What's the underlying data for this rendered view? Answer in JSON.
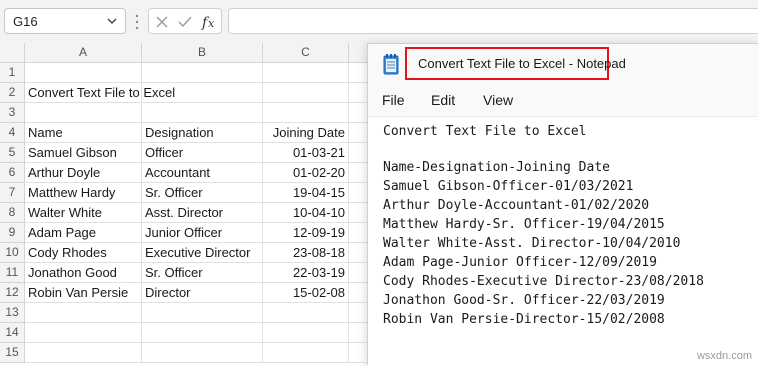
{
  "formula_bar": {
    "name_box": "G16",
    "formula": ""
  },
  "grid": {
    "columns": [
      "A",
      "B",
      "C"
    ],
    "row_numbers": [
      "1",
      "2",
      "3",
      "4",
      "5",
      "6",
      "7",
      "8",
      "9",
      "10",
      "11",
      "12",
      "13",
      "14",
      "15"
    ],
    "rows": [
      [
        "",
        "",
        ""
      ],
      [
        "Convert Text File to Excel",
        "",
        ""
      ],
      [
        "",
        "",
        ""
      ],
      [
        "Name",
        "Designation",
        "Joining Date"
      ],
      [
        "Samuel Gibson",
        "Officer",
        "01-03-21"
      ],
      [
        "Arthur Doyle",
        "Accountant",
        "01-02-20"
      ],
      [
        "Matthew Hardy",
        "Sr. Officer",
        "19-04-15"
      ],
      [
        "Walter White",
        "Asst. Director",
        "10-04-10"
      ],
      [
        "Adam Page",
        "Junior Officer",
        "12-09-19"
      ],
      [
        "Cody Rhodes",
        "Executive Director",
        "23-08-18"
      ],
      [
        "Jonathon Good",
        "Sr. Officer",
        "22-03-19"
      ],
      [
        "Robin Van Persie",
        "Director",
        "15-02-08"
      ],
      [
        "",
        "",
        ""
      ],
      [
        "",
        "",
        ""
      ],
      [
        "",
        "",
        ""
      ]
    ]
  },
  "notepad": {
    "title": "Convert Text File to Excel - Notepad",
    "menu": [
      "File",
      "Edit",
      "View"
    ],
    "lines": [
      "Convert Text File to Excel",
      "",
      "Name-Designation-Joining Date",
      "Samuel Gibson-Officer-01/03/2021",
      "Arthur Doyle-Accountant-01/02/2020",
      "Matthew Hardy-Sr. Officer-19/04/2015",
      "Walter White-Asst. Director-10/04/2010",
      "Adam Page-Junior Officer-12/09/2019",
      "Cody Rhodes-Executive Director-23/08/2018",
      "Jonathon Good-Sr. Officer-22/03/2019",
      "Robin Van Persie-Director-15/02/2008"
    ]
  },
  "watermark": "wsxdn.com",
  "colors": {
    "highlight_border": "#e0141e",
    "header_bg": "#f3f3f3"
  }
}
